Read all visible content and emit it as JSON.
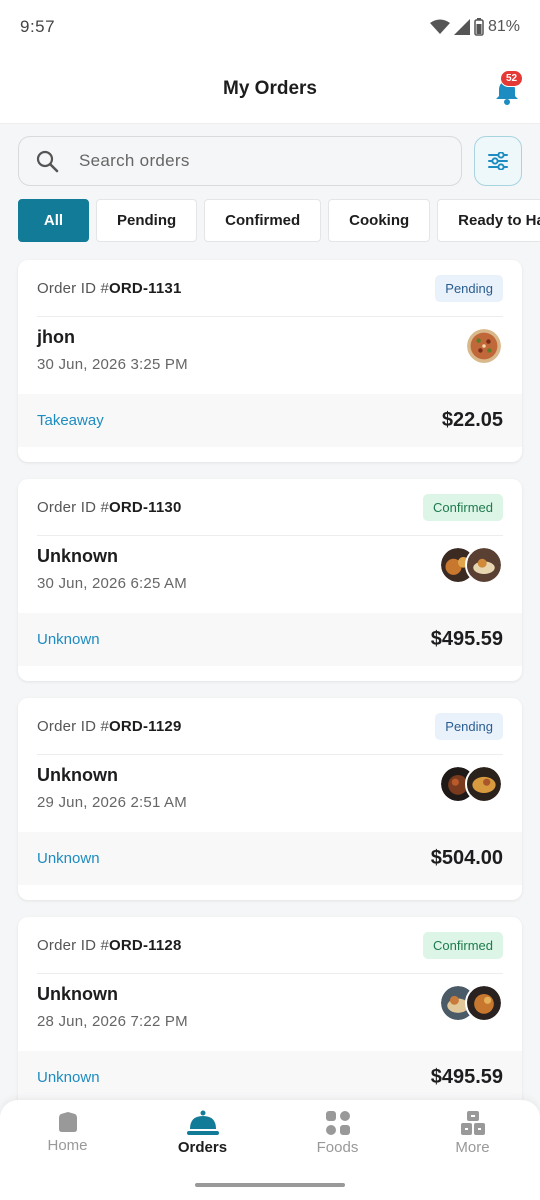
{
  "status_bar": {
    "time": "9:57",
    "battery": "81%"
  },
  "header": {
    "title": "My Orders",
    "notification_count": "52"
  },
  "search": {
    "placeholder": "Search orders"
  },
  "filters": [
    "All",
    "Pending",
    "Confirmed",
    "Cooking",
    "Ready to Ha"
  ],
  "order_id_prefix": "Order ID #",
  "orders": [
    {
      "id": "ORD-1131",
      "status": "Pending",
      "customer": "jhon",
      "date": "30 Jun, 2026 3:25 PM",
      "type": "Takeaway",
      "total": "$22.05"
    },
    {
      "id": "ORD-1130",
      "status": "Confirmed",
      "customer": "Unknown",
      "date": "30 Jun, 2026 6:25 AM",
      "type": "Unknown",
      "total": "$495.59"
    },
    {
      "id": "ORD-1129",
      "status": "Pending",
      "customer": "Unknown",
      "date": "29 Jun, 2026 2:51 AM",
      "type": "Unknown",
      "total": "$504.00"
    },
    {
      "id": "ORD-1128",
      "status": "Confirmed",
      "customer": "Unknown",
      "date": "28 Jun, 2026 7:22 PM",
      "type": "Unknown",
      "total": "$495.59"
    }
  ],
  "bottom_nav": [
    {
      "label": "Home",
      "icon": "home-icon"
    },
    {
      "label": "Orders",
      "icon": "service-bell-icon"
    },
    {
      "label": "Foods",
      "icon": "grid-icon"
    },
    {
      "label": "More",
      "icon": "more-icon"
    }
  ],
  "colors": {
    "accent": "#127b98",
    "link": "#1d8cc0",
    "badge": "#e53935"
  }
}
